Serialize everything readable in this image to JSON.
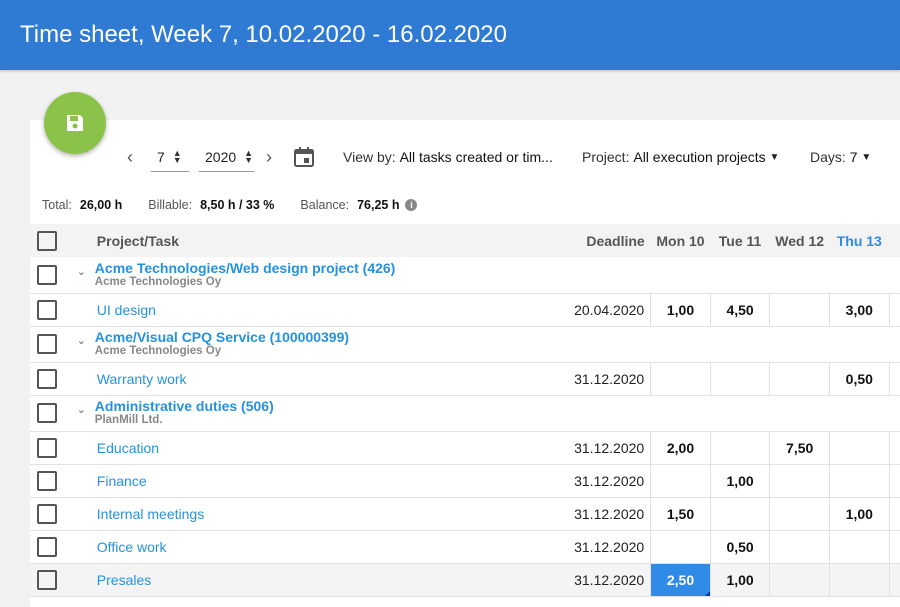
{
  "header": {
    "title": "Time sheet, Week 7, 10.02.2020 - 16.02.2020"
  },
  "toolbar": {
    "week": "7",
    "year": "2020",
    "view_by_label": "View by:",
    "view_by_value": "All tasks created or tim...",
    "project_label": "Project:",
    "project_value": "All execution projects",
    "days_label": "Days:",
    "days_value": "7"
  },
  "summary": {
    "total_label": "Total:",
    "total_value": "26,00 h",
    "billable_label": "Billable:",
    "billable_value": "8,50 h / 33 %",
    "balance_label": "Balance:",
    "balance_value": "76,25 h"
  },
  "table": {
    "headers": {
      "task": "Project/Task",
      "deadline": "Deadline",
      "days": [
        "Mon 10",
        "Tue 11",
        "Wed 12",
        "Thu 13"
      ]
    },
    "groups": [
      {
        "title": "Acme Technologies/Web design project (426)",
        "subtitle": "Acme Technologies Oy",
        "tasks": [
          {
            "name": "UI design",
            "deadline": "20.04.2020",
            "hours": [
              "1,00",
              "4,50",
              "",
              "3,00"
            ]
          }
        ]
      },
      {
        "title": "Acme/Visual CPQ Service (100000399)",
        "subtitle": "Acme Technologies Oy",
        "tasks": [
          {
            "name": "Warranty work",
            "deadline": "31.12.2020",
            "hours": [
              "",
              "",
              "",
              "0,50"
            ]
          }
        ]
      },
      {
        "title": "Administrative duties (506)",
        "subtitle": "PlanMill Ltd.",
        "tasks": [
          {
            "name": "Education",
            "deadline": "31.12.2020",
            "hours": [
              "2,00",
              "",
              "7,50",
              ""
            ]
          },
          {
            "name": "Finance",
            "deadline": "31.12.2020",
            "hours": [
              "",
              "1,00",
              "",
              ""
            ]
          },
          {
            "name": "Internal meetings",
            "deadline": "31.12.2020",
            "hours": [
              "1,50",
              "",
              "",
              "1,00"
            ]
          },
          {
            "name": "Office work",
            "deadline": "31.12.2020",
            "hours": [
              "",
              "0,50",
              "",
              ""
            ]
          },
          {
            "name": "Presales",
            "deadline": "31.12.2020",
            "hours": [
              "2,50",
              "1,00",
              "",
              ""
            ]
          }
        ]
      }
    ]
  },
  "colors": {
    "header": "#2f7ad3",
    "fab": "#8bc34a",
    "link": "#2592e0",
    "selected_cell": "#2f8be6"
  },
  "icons": {
    "save": "floppy-disk-icon",
    "calendar": "calendar-icon",
    "info": "info-icon"
  }
}
